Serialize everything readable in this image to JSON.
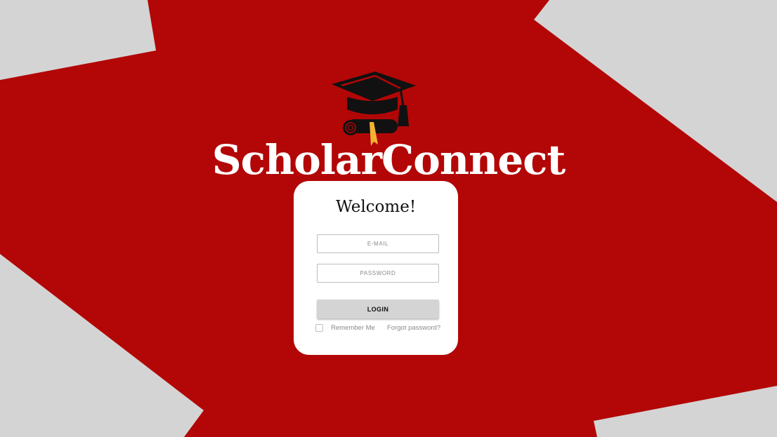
{
  "brand": {
    "name": "ScholarConnect"
  },
  "login": {
    "heading": "Welcome!",
    "email_placeholder": "E-MAIL",
    "password_placeholder": "PASSWORD",
    "submit_label": "LOGIN",
    "remember_label": "Remember Me",
    "forgot_label": "Forgot password?"
  },
  "icons": {
    "logo": "graduation-cap-diploma-icon"
  },
  "colors": {
    "background_red": "#b30606",
    "shape_gray": "#d4d4d4",
    "card": "#ffffff",
    "button": "#d4d4d4",
    "tassel": "#f4b233"
  }
}
